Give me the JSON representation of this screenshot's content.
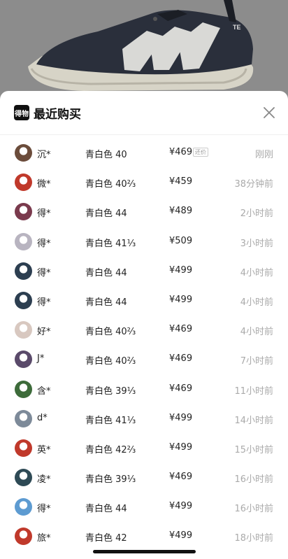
{
  "sheet": {
    "title": "最近购买",
    "logo_text": "得物"
  },
  "rows": [
    {
      "name": "沉*",
      "spec": "青白色 40",
      "price": "¥469",
      "badge": "还价",
      "time": "刚刚",
      "avatar_color": "#6b4c3b"
    },
    {
      "name": "微*",
      "spec": "青白色 40⅔",
      "price": "¥459",
      "badge": "",
      "time": "38分钟前",
      "avatar_color": "#c0392b"
    },
    {
      "name": "得*",
      "spec": "青白色 44",
      "price": "¥489",
      "badge": "",
      "time": "2小时前",
      "avatar_color": "#7a3a4d"
    },
    {
      "name": "得*",
      "spec": "青白色 41⅓",
      "price": "¥509",
      "badge": "",
      "time": "3小时前",
      "avatar_color": "#b8b4c0"
    },
    {
      "name": "得*",
      "spec": "青白色 44",
      "price": "¥499",
      "badge": "",
      "time": "4小时前",
      "avatar_color": "#2c3e50"
    },
    {
      "name": "得*",
      "spec": "青白色 44",
      "price": "¥499",
      "badge": "",
      "time": "4小时前",
      "avatar_color": "#2c3e50"
    },
    {
      "name": "好*",
      "spec": "青白色 40⅔",
      "price": "¥469",
      "badge": "",
      "time": "4小时前",
      "avatar_color": "#d8c8c0"
    },
    {
      "name": "J*",
      "spec": "青白色 40⅔",
      "price": "¥469",
      "badge": "",
      "time": "7小时前",
      "avatar_color": "#5a4a6a"
    },
    {
      "name": "含*",
      "spec": "青白色 39⅓",
      "price": "¥469",
      "badge": "",
      "time": "11小时前",
      "avatar_color": "#3d6b3a"
    },
    {
      "name": "d*",
      "spec": "青白色 41⅓",
      "price": "¥499",
      "badge": "",
      "time": "14小时前",
      "avatar_color": "#7d8a99"
    },
    {
      "name": "英*",
      "spec": "青白色 42⅔",
      "price": "¥499",
      "badge": "",
      "time": "15小时前",
      "avatar_color": "#c0392b"
    },
    {
      "name": "凌*",
      "spec": "青白色 39⅓",
      "price": "¥469",
      "badge": "",
      "time": "16小时前",
      "avatar_color": "#2e4a55"
    },
    {
      "name": "得*",
      "spec": "青白色 44",
      "price": "¥499",
      "badge": "",
      "time": "16小时前",
      "avatar_color": "#5d9bd1"
    },
    {
      "name": "旅*",
      "spec": "青白色 42",
      "price": "¥499",
      "badge": "",
      "time": "18小时前",
      "avatar_color": "#c0392b"
    }
  ]
}
